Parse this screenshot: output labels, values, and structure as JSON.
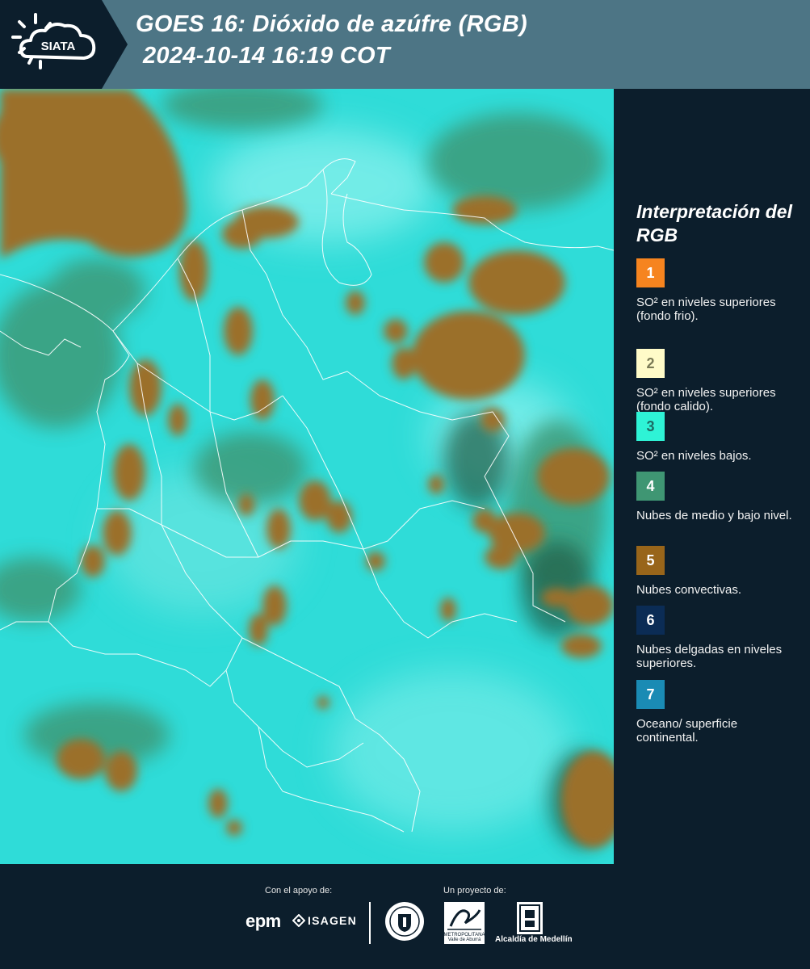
{
  "header": {
    "logo_text": "SIATA",
    "title_line1": "GOES 16: Dióxido de azúfre (RGB)",
    "title_line2": "2024-10-14 16:19 COT"
  },
  "legend": {
    "title": "Interpretación del RGB",
    "items": [
      {
        "number": "1",
        "color": "#f6841f",
        "text_color": "#ffffff",
        "label": "SO² en niveles superiores (fondo frio)."
      },
      {
        "number": "2",
        "color": "#fffbc8",
        "text_color": "#7a7a55",
        "label": "SO² en niveles superiores (fondo calido)."
      },
      {
        "number": "3",
        "color": "#2ef3d6",
        "text_color": "#1c6b63",
        "label": "SO² en niveles bajos."
      },
      {
        "number": "4",
        "color": "#3f9673",
        "text_color": "#ffffff",
        "label": "Nubes de medio y bajo nivel."
      },
      {
        "number": "5",
        "color": "#98651a",
        "text_color": "#ffffff",
        "label": "Nubes convectivas."
      },
      {
        "number": "6",
        "color": "#0b2c55",
        "text_color": "#ffffff",
        "label": "Nubes delgadas en niveles superiores."
      },
      {
        "number": "7",
        "color": "#1a8bb4",
        "text_color": "#ffffff",
        "label": "Oceano/ superficie continental."
      }
    ]
  },
  "footer": {
    "support_label": "Con el apoyo de:",
    "project_label": "Un proyecto de:",
    "sponsors": [
      "epm",
      "ISAGEN"
    ],
    "area_caption": "METROPOLITANA Valle de Aburrá",
    "alcaldia_label": "Alcaldía de Medellín"
  },
  "colors": {
    "header_bg": "#4d7585",
    "panel_bg": "#0c1e2c",
    "map_base": "#2fdcd8",
    "cloud_convective": "#9b6f2c",
    "cloud_mid": "#3d9a78"
  }
}
